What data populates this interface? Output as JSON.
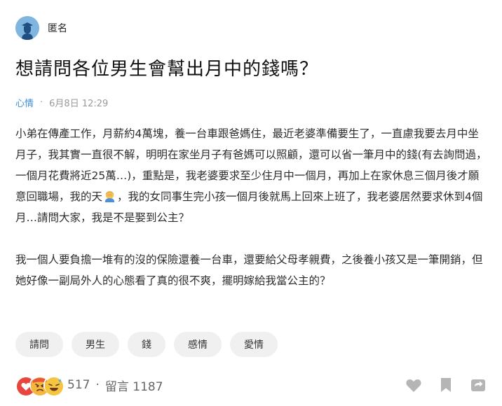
{
  "author": {
    "name": "匿名",
    "avatar_icon": "anonymous-user-icon"
  },
  "post": {
    "title": "想請問各位男生會幫出月中的錢嗎？",
    "board": "心情",
    "date": "6月8日 12:29",
    "paragraph1_part1": "小弟在傳產工作，月薪約4萬塊，養一台車跟爸媽住，最近老婆準備要生了，一直慮我要去月中坐月子，我其實一直很不解，明明在家坐月子有爸媽可以照顧，還可以省一筆月中的錢(有去詢問過，一個月花費將近25萬…)，重點是，我老婆要求至少住月中一個月，再加上在家休息三個月後才願意回職場，我的天",
    "paragraph1_emoji": "facepalm-emoji",
    "paragraph1_part2": "，我的女同事生完小孩一個月後就馬上回來上班了，我老婆居然要求休到4個月…請問大家，我是不是娶到公主？",
    "paragraph2": "我一個人要負擔一堆有的沒的保險還養一台車，還要給父母孝親費，之後養小孩又是一筆開銷，但她好像一副局外人的心態看了真的很不爽，擺明嫁給我當公主的？"
  },
  "tags": [
    "請問",
    "男生",
    "錢",
    "感情",
    "愛情"
  ],
  "footer": {
    "reaction_icons": [
      "heart-reaction-icon",
      "angry-reaction-icon",
      "laugh-reaction-icon"
    ],
    "reaction_count": "517",
    "separator": "·",
    "comments_label": "留言 1187",
    "actions": [
      "like-heart-icon",
      "bookmark-icon",
      "share-icon"
    ]
  },
  "colors": {
    "board_link": "#3d8fd6",
    "tag_bg": "#f0f0f0",
    "text": "#2d2d2d",
    "meta": "#9a9a9a"
  }
}
